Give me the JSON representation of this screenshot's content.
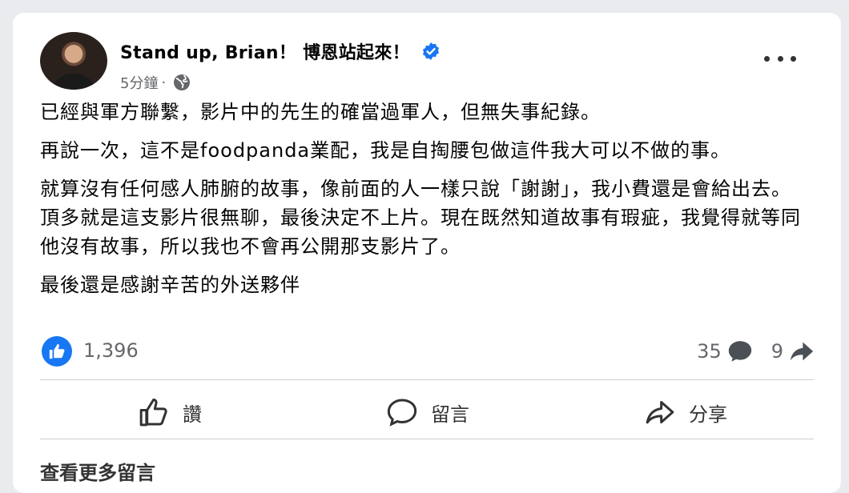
{
  "post": {
    "author": "Stand up, Brian！ 博恩站起來！",
    "time": "5分鐘",
    "separator": "·",
    "paragraphs": [
      "已經與軍方聯繫，影片中的先生的確當過軍人，但無失事紀錄。",
      "再說一次，這不是foodpanda業配，我是自掏腰包做這件我大可以不做的事。",
      "就算沒有任何感人肺腑的故事，像前面的人一樣只說「謝謝」，我小費還是會給出去。頂多就是這支影片很無聊，最後決定不上片。現在既然知道故事有瑕疵，我覺得就等同他沒有故事，所以我也不會再公開那支影片了。",
      "最後還是感謝辛苦的外送夥伴"
    ],
    "likes": "1,396",
    "comments": "35",
    "shares": "9"
  },
  "actions": {
    "like": "讚",
    "comment": "留言",
    "share": "分享"
  },
  "see_more": "查看更多留言",
  "colors": {
    "accent": "#1877f2",
    "muted": "#65676b"
  },
  "icons": [
    "verified-badge-icon",
    "globe-icon",
    "more-options-icon",
    "like-reaction-icon",
    "comment-icon",
    "share-icon",
    "thumbs-up-icon",
    "comment-bubble-icon",
    "share-arrow-icon"
  ]
}
